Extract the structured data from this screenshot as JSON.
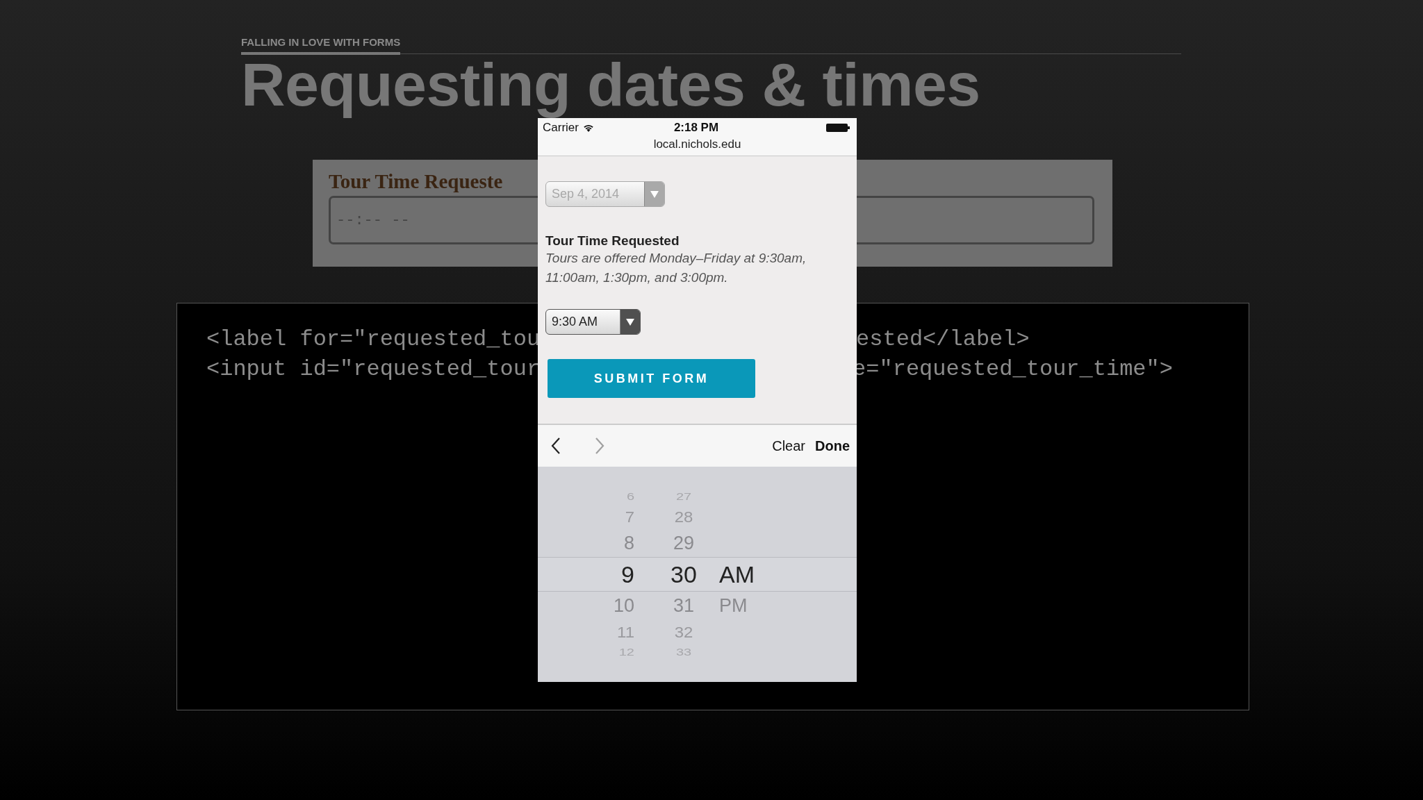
{
  "slide": {
    "kicker": "FALLING IN LOVE WITH FORMS",
    "title": "Requesting dates & times",
    "example_field": {
      "label": "Tour Time Requeste",
      "placeholder": "--:-- --"
    },
    "code_lines": [
      {
        "left": "<label for=\"requested_tou",
        "right": "ested</label>"
      },
      {
        "left": "<input id=\"requested_tour",
        "right": "e=\"requested_tour_time\">"
      }
    ]
  },
  "phone": {
    "status_bar": {
      "carrier": "Carrier",
      "time": "2:18 PM"
    },
    "url": "local.nichols.edu",
    "date_select": {
      "value": "Sep 4, 2014",
      "disabled": true
    },
    "field_label": "Tour Time Requested",
    "hint": "Tours are offered Monday–Friday at 9:30am, 11:00am, 1:30pm, and 3:00pm.",
    "time_select": {
      "value": "9:30 AM",
      "disabled": false
    },
    "submit": "SUBMIT FORM",
    "toolbar": {
      "nav": [
        {
          "kind": "previous",
          "disabled": false
        },
        {
          "kind": "next",
          "disabled": true
        }
      ],
      "clear": "Clear",
      "done": "Done"
    },
    "picker": {
      "columns": [
        {
          "kind": "hour",
          "items": [
            {
              "label": "6",
              "selected": false
            },
            {
              "label": "7",
              "selected": false
            },
            {
              "label": "8",
              "selected": false
            },
            {
              "label": "9",
              "selected": true
            },
            {
              "label": "10",
              "selected": false
            },
            {
              "label": "11",
              "selected": false
            },
            {
              "label": "12",
              "selected": false
            }
          ]
        },
        {
          "kind": "minute",
          "items": [
            {
              "label": "27",
              "selected": false
            },
            {
              "label": "28",
              "selected": false
            },
            {
              "label": "29",
              "selected": false
            },
            {
              "label": "30",
              "selected": true
            },
            {
              "label": "31",
              "selected": false
            },
            {
              "label": "32",
              "selected": false
            },
            {
              "label": "33",
              "selected": false
            }
          ]
        },
        {
          "kind": "period",
          "items": [
            {
              "label": "AM",
              "selected": true
            },
            {
              "label": "PM",
              "selected": false
            }
          ]
        }
      ]
    }
  }
}
